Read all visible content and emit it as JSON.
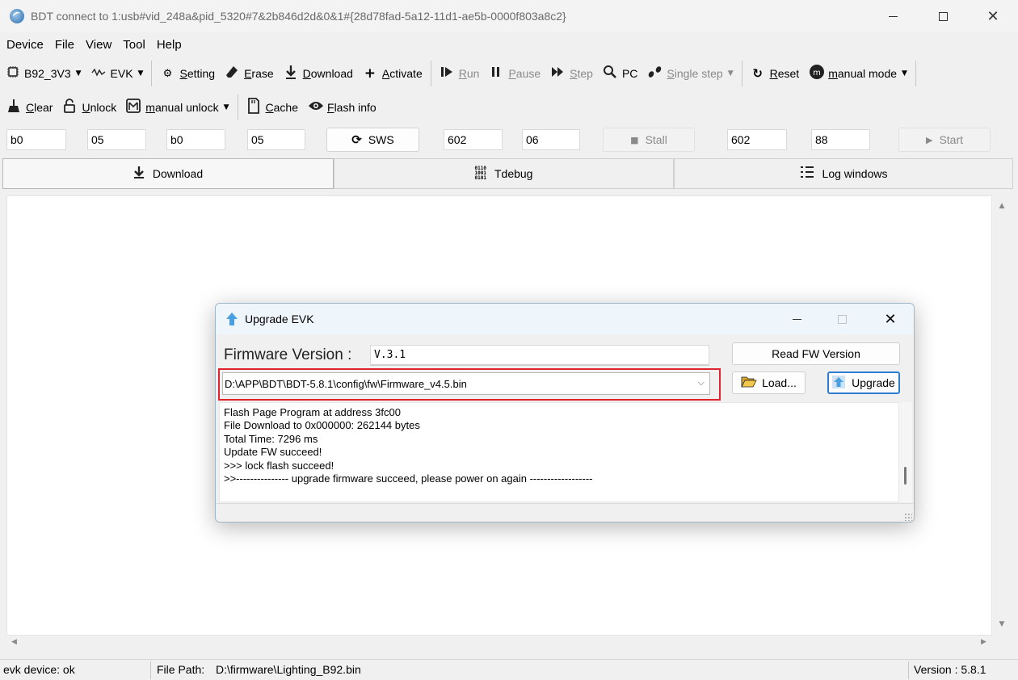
{
  "window": {
    "title": "BDT connect to 1:usb#vid_248a&pid_5320#7&2b846d2d&0&1#{28d78fad-5a12-11d1-ae5b-0000f803a8c2}"
  },
  "menu": [
    "Device",
    "File",
    "View",
    "Tool",
    "Help"
  ],
  "toolbar1": {
    "chip": "B92_3V3",
    "evk": "EVK",
    "setting": "Setting",
    "erase": "Erase",
    "download": "Download",
    "activate": "Activate",
    "run": "Run",
    "pause": "Pause",
    "step": "Step",
    "pc": "PC",
    "single_step": "Single step",
    "reset": "Reset",
    "manual_mode": "manual mode"
  },
  "toolbar2": {
    "clear": "Clear",
    "unlock": "Unlock",
    "manual_unlock": "manual unlock",
    "cache": "Cache",
    "flash_info": "Flash info"
  },
  "params": {
    "f1": "b0",
    "f2": "05",
    "f3": "b0",
    "f4": "05",
    "sws": "SWS",
    "f5": "602",
    "f6": "06",
    "stall": "Stall",
    "f7": "602",
    "f8": "88",
    "start": "Start"
  },
  "tabs": {
    "download": "Download",
    "tdebug": "Tdebug",
    "log_windows": "Log windows"
  },
  "dialog": {
    "title": "Upgrade EVK",
    "fw_label": "Firmware Version :",
    "fw_value": "V.3.1",
    "read_fw": "Read FW Version",
    "path": "D:\\APP\\BDT\\BDT-5.8.1\\config\\fw\\Firmware_v4.5.bin",
    "load": "Load...",
    "upgrade": "Upgrade",
    "log": [
      "Flash Page Program at address 3fc00",
      "File Download to 0x000000: 262144 bytes",
      "Total Time: 7296 ms",
      "Update FW succeed!",
      ">>> lock flash succeed!",
      ">>--------------- upgrade firmware succeed, please power on again ------------------"
    ]
  },
  "status": {
    "device": "evk device: ok",
    "file_label": "File Path:",
    "file_path": "D:\\firmware\\Lighting_B92.bin",
    "version": "Version : 5.8.1"
  },
  "icons": {
    "app": "bdt-globe-icon",
    "upgrade": "blue-up-arrow-icon",
    "load": "folder-open-icon"
  },
  "colors": {
    "highlight": "#e0232f",
    "primary_border": "#2f7dd1"
  }
}
